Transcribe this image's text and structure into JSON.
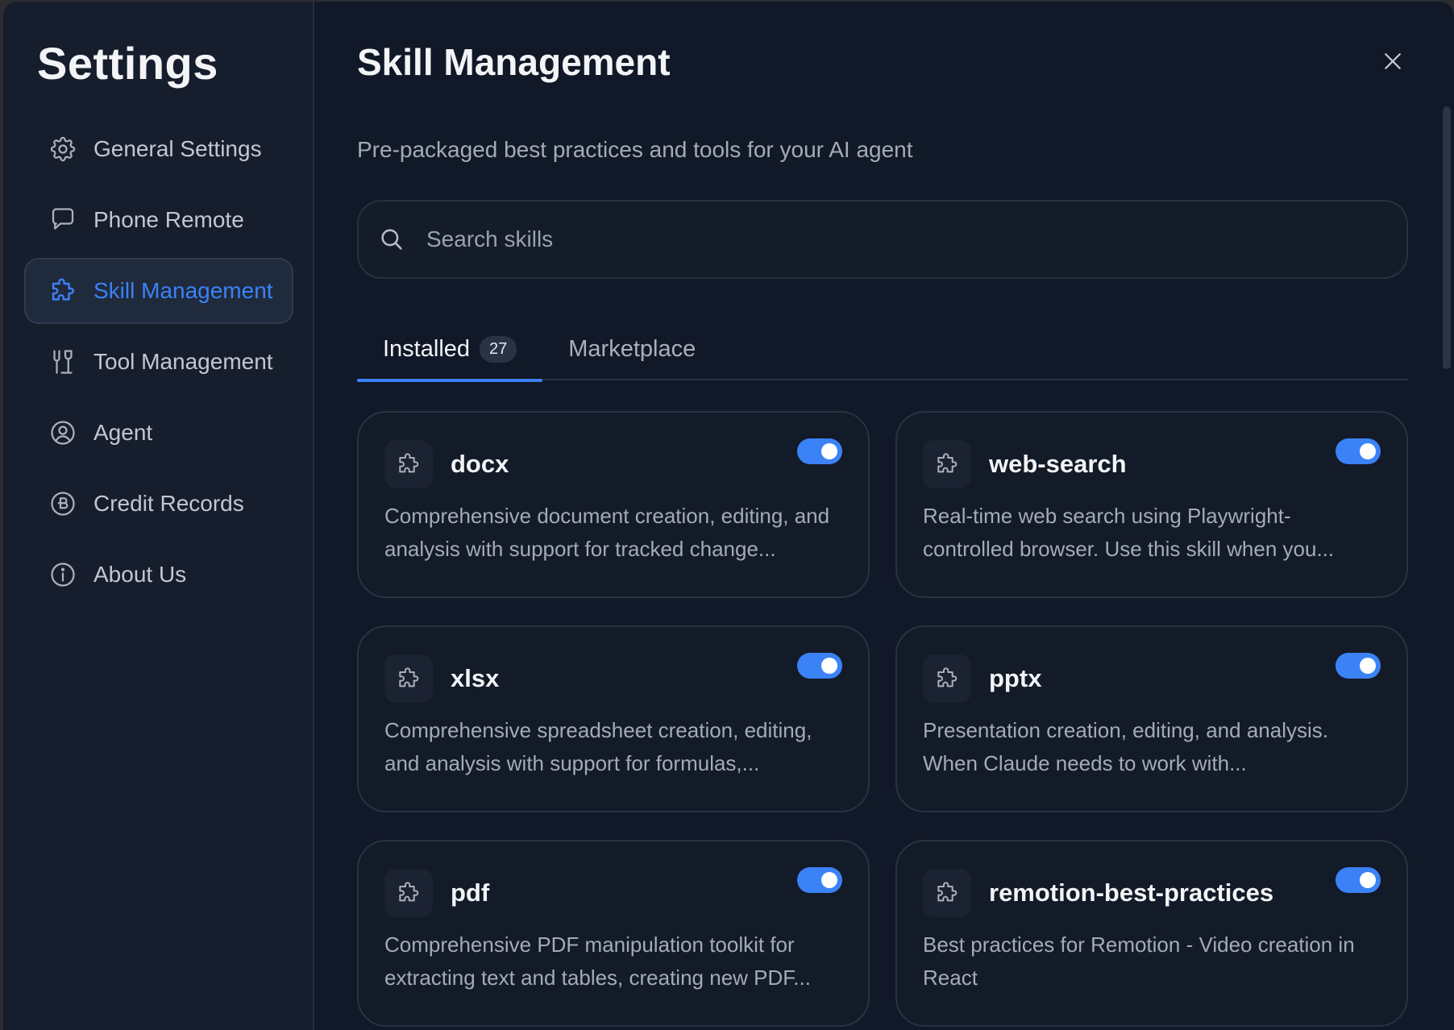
{
  "sidebar": {
    "title": "Settings",
    "items": [
      {
        "label": "General Settings",
        "icon": "gear-icon"
      },
      {
        "label": "Phone Remote",
        "icon": "chat-bubble-icon"
      },
      {
        "label": "Skill Management",
        "icon": "puzzle-icon",
        "active": true
      },
      {
        "label": "Tool Management",
        "icon": "tools-icon"
      },
      {
        "label": "Agent",
        "icon": "user-circle-icon"
      },
      {
        "label": "Credit Records",
        "icon": "coin-icon"
      },
      {
        "label": "About Us",
        "icon": "info-icon"
      }
    ]
  },
  "main": {
    "title": "Skill Management",
    "subtitle": "Pre-packaged best practices and tools for your AI agent",
    "search": {
      "placeholder": "Search skills",
      "value": ""
    },
    "tabs": [
      {
        "label": "Installed",
        "badge": "27",
        "active": true
      },
      {
        "label": "Marketplace",
        "active": false
      }
    ],
    "skills": [
      {
        "name": "docx",
        "description": "Comprehensive document creation, editing, and analysis with support for tracked change...",
        "enabled": true
      },
      {
        "name": "web-search",
        "description": "Real-time web search using Playwright-controlled browser. Use this skill when you...",
        "enabled": true
      },
      {
        "name": "xlsx",
        "description": "Comprehensive spreadsheet creation, editing, and analysis with support for formulas,...",
        "enabled": true
      },
      {
        "name": "pptx",
        "description": "Presentation creation, editing, and analysis. When Claude needs to work with...",
        "enabled": true
      },
      {
        "name": "pdf",
        "description": "Comprehensive PDF manipulation toolkit for extracting text and tables, creating new PDF...",
        "enabled": true
      },
      {
        "name": "remotion-best-practices",
        "description": "Best practices for Remotion - Video creation in React",
        "enabled": true
      }
    ]
  },
  "colors": {
    "accent": "#3b82f6",
    "background": "#111827",
    "sidebar": "#161d2c"
  }
}
